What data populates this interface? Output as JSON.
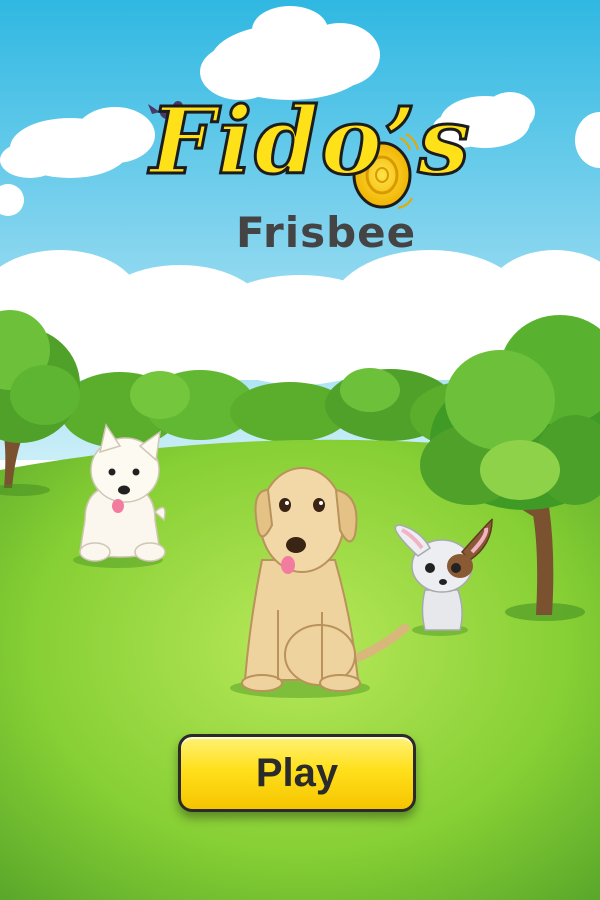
{
  "game": {
    "title": "Fido’s",
    "subtitle": "Frisbee"
  },
  "menu": {
    "play_label": "Play"
  },
  "colors": {
    "sky_top": "#3cbfe3",
    "grass": "#8fd33a",
    "button": "#ffe01c",
    "title": "#ffe11a"
  },
  "characters": [
    "bird",
    "westie-dog",
    "labrador-dog",
    "chihuahua-dog"
  ]
}
